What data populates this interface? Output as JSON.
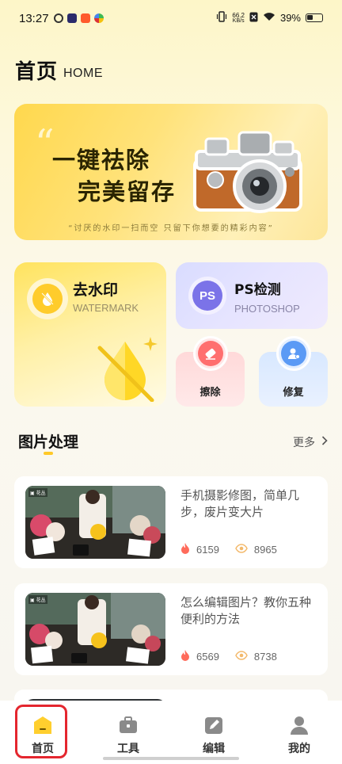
{
  "status_bar": {
    "time": "13:27",
    "net_speed_value": "66.2",
    "net_speed_unit": "KB/s",
    "battery": "39%"
  },
  "header": {
    "title": "首页",
    "subtitle": "HOME"
  },
  "banner": {
    "line1": "一键祛除",
    "line2": "完美留存",
    "caption": "“讨厌的水印一扫而空 只留下你想要的精彩内容”"
  },
  "features": {
    "watermark": {
      "title": "去水印",
      "subtitle": "WATERMARK"
    },
    "ps_detect": {
      "title": "PS检测",
      "subtitle": "PHOTOSHOP",
      "icon_text": "PS"
    },
    "erase": {
      "label": "擦除"
    },
    "repair": {
      "label": "修复"
    }
  },
  "section": {
    "title": "图片处理",
    "more": "更多"
  },
  "articles": [
    {
      "title": "手机摄影修图，简单几步，废片变大片",
      "likes": "6159",
      "views": "8965"
    },
    {
      "title": "怎么编辑图片？教你五种便利的方法",
      "likes": "6569",
      "views": "8738"
    }
  ],
  "bottom_nav": {
    "items": [
      {
        "label": "首页",
        "icon": "home-icon",
        "active": true
      },
      {
        "label": "工具",
        "icon": "toolbox-icon"
      },
      {
        "label": "编辑",
        "icon": "edit-icon"
      },
      {
        "label": "我的",
        "icon": "user-icon"
      }
    ]
  },
  "colors": {
    "accent": "#ffc928",
    "highlight_box": "#e4262e",
    "fire": "#ff6b5b",
    "eye": "#f3b96b"
  }
}
